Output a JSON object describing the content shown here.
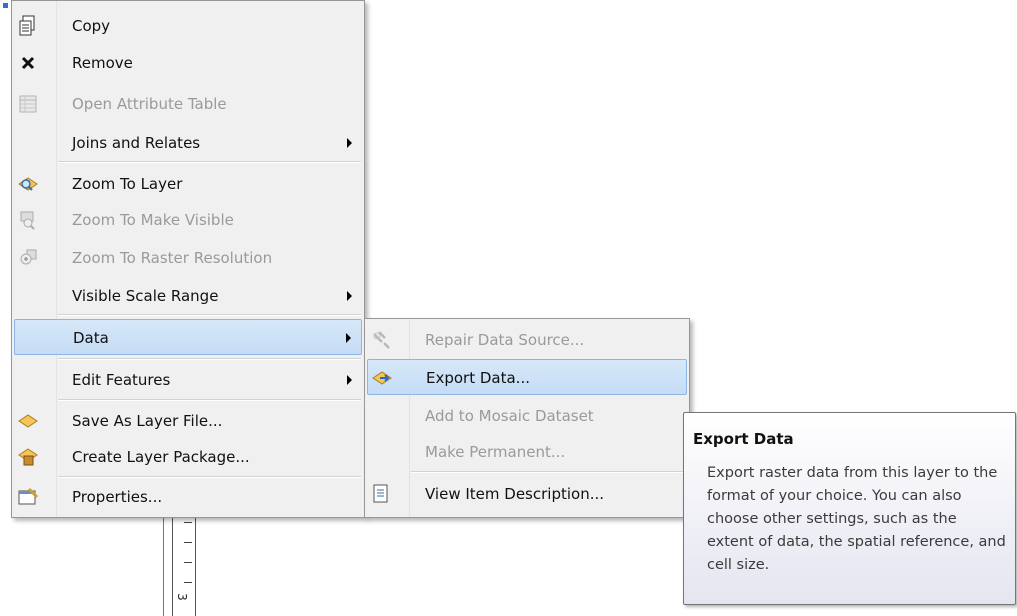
{
  "main_menu": {
    "items": [
      {
        "label": "Copy",
        "icon": "copy-icon",
        "enabled": true
      },
      {
        "label": "Remove",
        "icon": "remove-x-icon",
        "enabled": true
      },
      {
        "label": "Open Attribute Table",
        "icon": "table-icon",
        "enabled": false
      },
      {
        "label": "Joins and Relates",
        "icon": "",
        "enabled": true,
        "submenu": true
      },
      {
        "label": "Zoom To Layer",
        "icon": "zoom-to-layer-icon",
        "enabled": true
      },
      {
        "label": "Zoom To Make Visible",
        "icon": "zoom-visible-icon",
        "enabled": false
      },
      {
        "label": "Zoom To Raster Resolution",
        "icon": "zoom-raster-icon",
        "enabled": false
      },
      {
        "label": "Visible Scale Range",
        "icon": "",
        "enabled": true,
        "submenu": true
      },
      {
        "label": "Data",
        "icon": "",
        "enabled": true,
        "submenu": true,
        "highlighted": true
      },
      {
        "label": "Edit Features",
        "icon": "",
        "enabled": true,
        "submenu": true
      },
      {
        "label": "Save As Layer File...",
        "icon": "layer-file-icon",
        "enabled": true
      },
      {
        "label": "Create Layer Package...",
        "icon": "layer-package-icon",
        "enabled": true
      },
      {
        "label": "Properties...",
        "icon": "properties-icon",
        "enabled": true
      }
    ]
  },
  "data_submenu": {
    "items": [
      {
        "label": "Repair Data Source...",
        "icon": "repair-icon",
        "enabled": false
      },
      {
        "label": "Export Data...",
        "icon": "export-data-icon",
        "enabled": true,
        "highlighted": true
      },
      {
        "label": "Add to Mosaic Dataset",
        "icon": "",
        "enabled": false
      },
      {
        "label": "Make Permanent...",
        "icon": "",
        "enabled": false
      },
      {
        "label": "View Item Description...",
        "icon": "item-description-icon",
        "enabled": true
      }
    ]
  },
  "tooltip": {
    "title": "Export Data",
    "body": "Export raster data from this layer to the format of your choice. You can also choose other settings, such as the extent of data, the spatial reference, and cell size."
  },
  "ruler": {
    "label": "3"
  },
  "colors": {
    "highlight": "#c4dcf5",
    "highlight_border": "#8fb6e3",
    "menu_bg": "#f0f0f0",
    "disabled_text": "#9a9a9a"
  }
}
